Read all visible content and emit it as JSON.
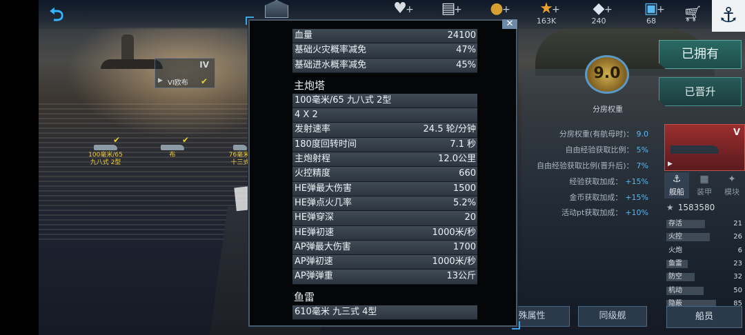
{
  "topbar": {
    "resources": [
      {
        "icon": "heart-icon",
        "glyph": "♥",
        "value": "",
        "color": "#d8dde2"
      },
      {
        "icon": "card-icon",
        "glyph": "▤",
        "value": "",
        "color": "#d8dde2"
      },
      {
        "icon": "coin-icon",
        "glyph": "●",
        "value": "",
        "color": "#d8a030"
      },
      {
        "icon": "star-icon",
        "glyph": "★",
        "value": "163K",
        "color": "#e8a030"
      },
      {
        "icon": "diamond-icon",
        "glyph": "◆",
        "value": "240",
        "color": "#d8e4ee"
      },
      {
        "icon": "cube-icon",
        "glyph": "▣",
        "value": "68",
        "color": "#5ab8f0"
      }
    ]
  },
  "left": {
    "ship_card": {
      "tier": "IV",
      "name": "VI欧布"
    },
    "tree_nodes": [
      {
        "line1": "100毫米/65",
        "line2": "九八式 2型"
      },
      {
        "line1": "布",
        "line2": ""
      },
      {
        "line1": "76毫米/",
        "line2": "十三式"
      }
    ]
  },
  "modal": {
    "top_rows": [
      {
        "k": "血量",
        "v": "24100"
      },
      {
        "k": "基础火灾概率减免",
        "v": "47%"
      },
      {
        "k": "基础进水概率减免",
        "v": "45%"
      }
    ],
    "turret_title": "主炮塔",
    "turret_rows": [
      {
        "k": "100毫米/65 九八式 2型",
        "v": ""
      },
      {
        "k": "4 X 2",
        "v": ""
      },
      {
        "k": "发射速率",
        "v": "24.5 轮/分钟"
      },
      {
        "k": "180度回转时间",
        "v": "7.1 秒"
      },
      {
        "k": "主炮射程",
        "v": "12.0公里"
      },
      {
        "k": "火控精度",
        "v": "660"
      },
      {
        "k": "HE弹最大伤害",
        "v": "1500"
      },
      {
        "k": "HE弹点火几率",
        "v": "5.2%"
      },
      {
        "k": "HE弹穿深",
        "v": "20"
      },
      {
        "k": "HE弹初速",
        "v": "1000米/秒"
      },
      {
        "k": "AP弹最大伤害",
        "v": "1700"
      },
      {
        "k": "AP弹初速",
        "v": "1000米/秒"
      },
      {
        "k": "AP弹弹重",
        "v": "13公斤"
      }
    ],
    "torpedo_title": "鱼雷",
    "torpedo_rows": [
      {
        "k": "610毫米 九三式 4型",
        "v": ""
      }
    ],
    "close_label": "✕"
  },
  "right": {
    "owned_label": "已拥有",
    "promoted_label": "已晋升",
    "score": "9.0",
    "score_label": "分房权重",
    "stats": [
      {
        "k": "分房权重(有航母时)：",
        "v": "9.0"
      },
      {
        "k": "自由经验获取比例：",
        "v": "5%"
      },
      {
        "k": "自由经验获取比例(晋升后)：",
        "v": "7%"
      },
      {
        "k": "经验获取加成：",
        "v": "+15%"
      },
      {
        "k": "金币获取加成：",
        "v": "+15%"
      },
      {
        "k": "活动pt获取加成：",
        "v": "+10%"
      }
    ],
    "ship_tier": "V",
    "tabs": [
      {
        "label": "舰船",
        "glyph": "⚓"
      },
      {
        "label": "装甲",
        "glyph": "▦"
      },
      {
        "label": "模块",
        "glyph": "✦"
      }
    ],
    "points": "1583580",
    "attributes": [
      {
        "label": "存活",
        "value": "21",
        "fill": 0.62
      },
      {
        "label": "火控",
        "value": "26",
        "fill": 0.7
      },
      {
        "label": "火炮",
        "value": "6",
        "fill": 0.0
      },
      {
        "label": "鱼雷",
        "value": "23",
        "fill": 0.35
      },
      {
        "label": "防空",
        "value": "32",
        "fill": 0.45
      },
      {
        "label": "机动",
        "value": "50",
        "fill": 0.6
      },
      {
        "label": "隐蔽",
        "value": "85",
        "fill": 0.8
      }
    ],
    "crew_label": "船员",
    "special_label": "殊属性",
    "sameclass_label": "同级舰"
  }
}
